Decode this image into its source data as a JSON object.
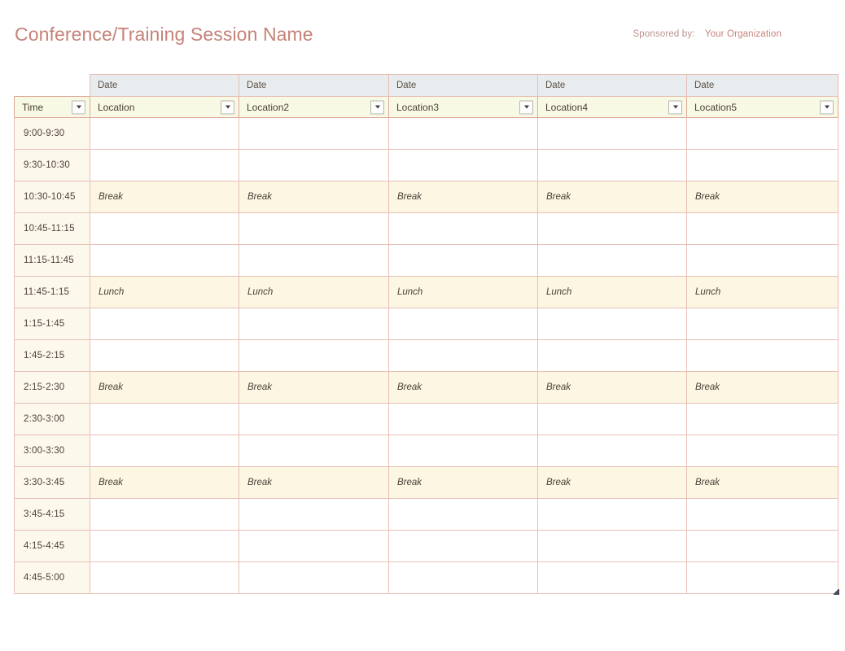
{
  "header": {
    "title": "Conference/Training Session Name",
    "sponsored_label": "Sponsored by:",
    "sponsored_value": "Your Organization",
    "title_color": "#c58378",
    "sponsor_color": "#c5837a"
  },
  "table": {
    "date_header_label": "Date",
    "time_column_header": "Time",
    "date_headers": [
      "Date",
      "Date",
      "Date",
      "Date",
      "Date"
    ],
    "location_headers": [
      "Location",
      "Location2",
      "Location3",
      "Location4",
      "Location5"
    ],
    "filter_icon": "chevron-down-icon",
    "colors": {
      "border": "#e7bfb4",
      "date_header_bg": "#e8ecee",
      "location_header_bg": "#f8f9e4",
      "time_cell_bg": "#fdf8ec",
      "shaded_row_bg": "#fdf6e3",
      "empty_cell_bg": "#ffffff"
    },
    "rows": [
      {
        "time": "9:00-9:30",
        "shaded": false,
        "cells": [
          "",
          "",
          "",
          "",
          ""
        ]
      },
      {
        "time": "9:30-10:30",
        "shaded": false,
        "cells": [
          "",
          "",
          "",
          "",
          ""
        ]
      },
      {
        "time": "10:30-10:45",
        "shaded": true,
        "cells": [
          "Break",
          "Break",
          "Break",
          "Break",
          "Break"
        ]
      },
      {
        "time": "10:45-11:15",
        "shaded": false,
        "cells": [
          "",
          "",
          "",
          "",
          ""
        ]
      },
      {
        "time": "11:15-11:45",
        "shaded": false,
        "cells": [
          "",
          "",
          "",
          "",
          ""
        ]
      },
      {
        "time": "11:45-1:15",
        "shaded": true,
        "cells": [
          "Lunch",
          "Lunch",
          "Lunch",
          "Lunch",
          "Lunch"
        ]
      },
      {
        "time": "1:15-1:45",
        "shaded": false,
        "cells": [
          "",
          "",
          "",
          "",
          ""
        ]
      },
      {
        "time": "1:45-2:15",
        "shaded": false,
        "cells": [
          "",
          "",
          "",
          "",
          ""
        ]
      },
      {
        "time": "2:15-2:30",
        "shaded": true,
        "cells": [
          "Break",
          "Break",
          "Break",
          "Break",
          "Break"
        ]
      },
      {
        "time": "2:30-3:00",
        "shaded": false,
        "cells": [
          "",
          "",
          "",
          "",
          ""
        ]
      },
      {
        "time": "3:00-3:30",
        "shaded": false,
        "cells": [
          "",
          "",
          "",
          "",
          ""
        ]
      },
      {
        "time": "3:30-3:45",
        "shaded": true,
        "cells": [
          "Break",
          "Break",
          "Break",
          "Break",
          "Break"
        ]
      },
      {
        "time": "3:45-4:15",
        "shaded": false,
        "cells": [
          "",
          "",
          "",
          "",
          ""
        ]
      },
      {
        "time": "4:15-4:45",
        "shaded": false,
        "cells": [
          "",
          "",
          "",
          "",
          ""
        ]
      },
      {
        "time": "4:45-5:00",
        "shaded": false,
        "cells": [
          "",
          "",
          "",
          "",
          ""
        ]
      }
    ]
  }
}
